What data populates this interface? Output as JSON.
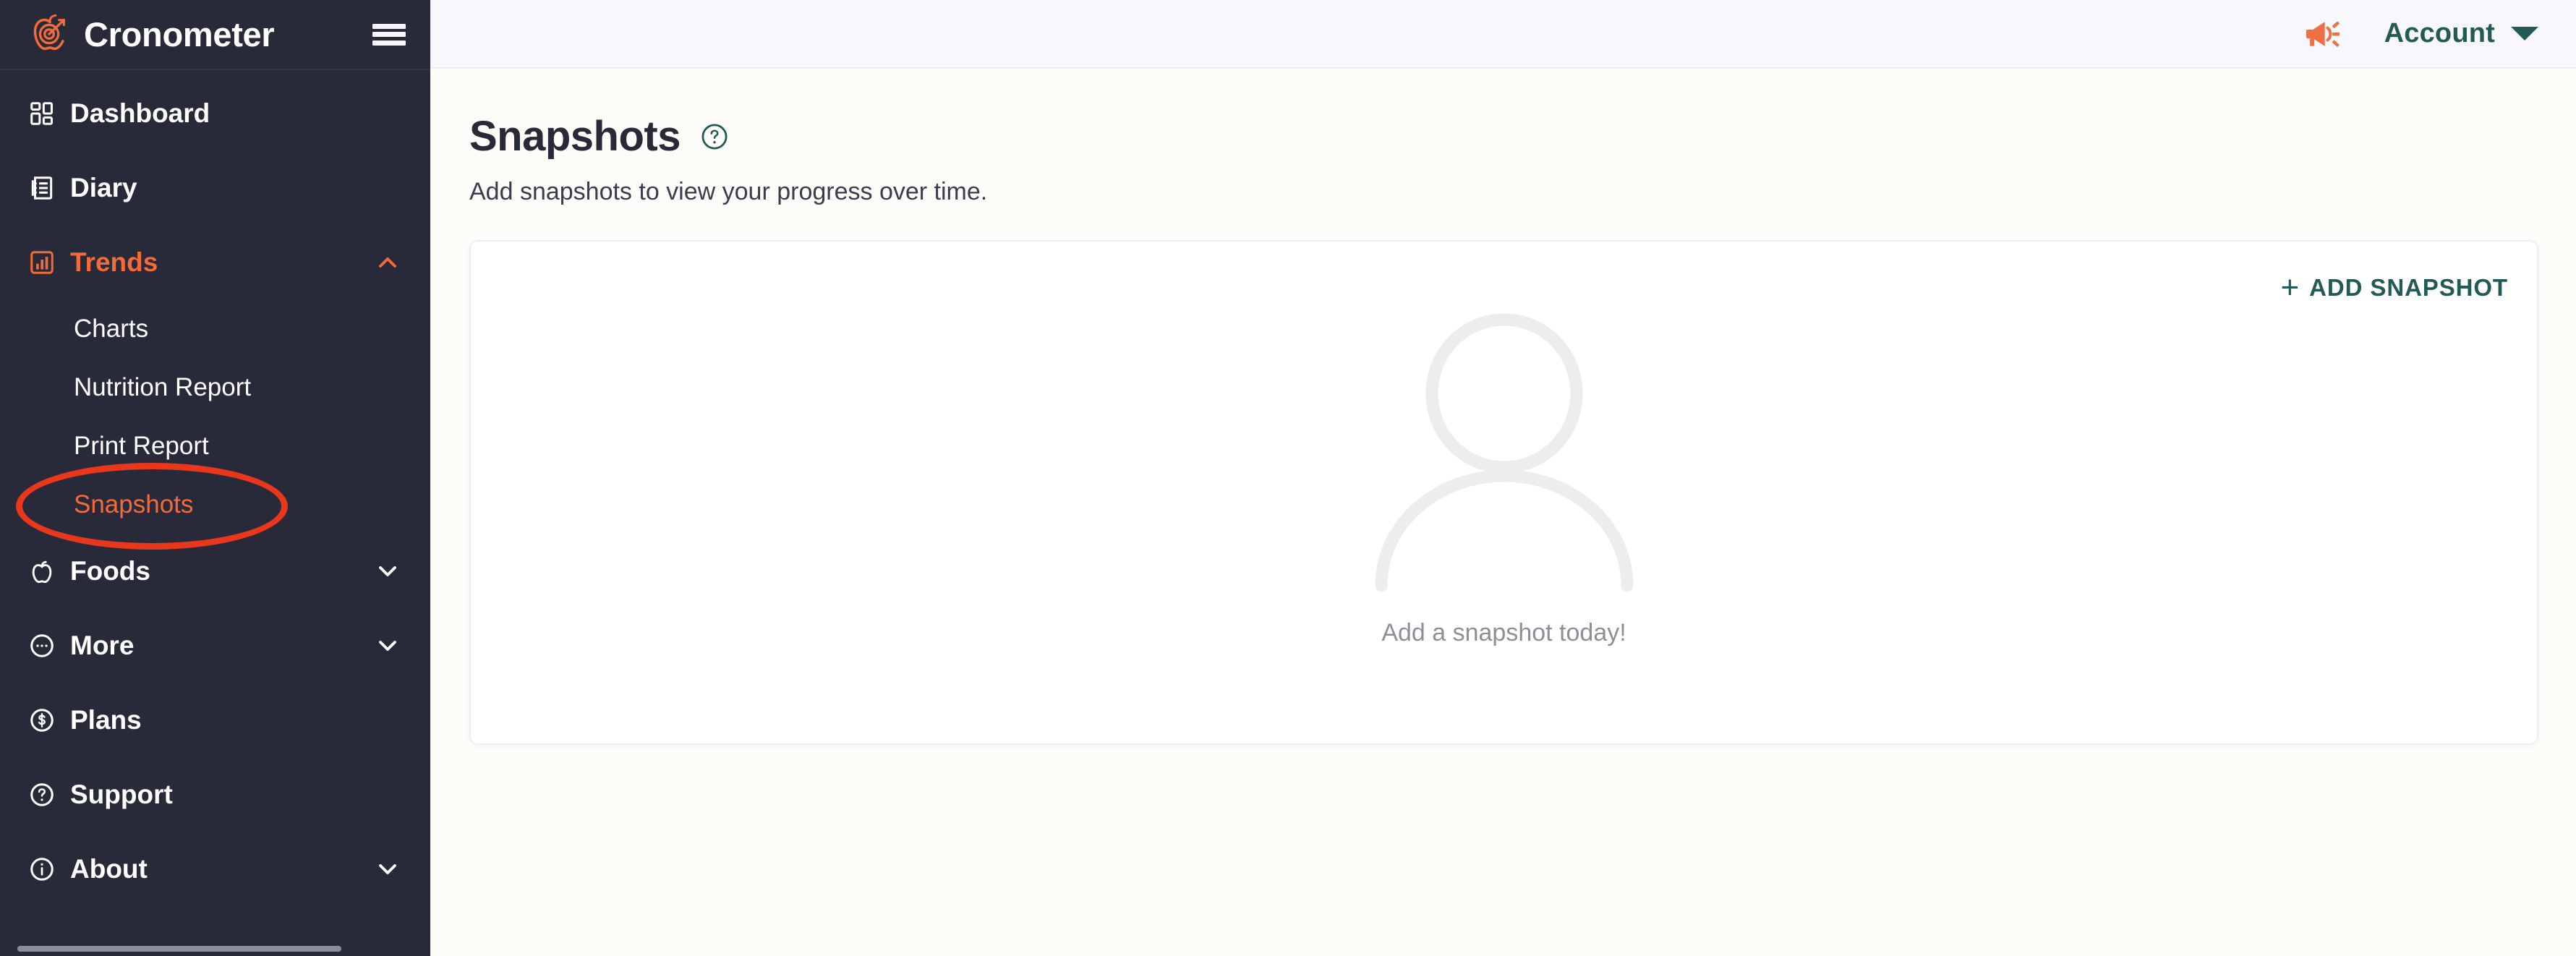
{
  "sidebar": {
    "brand": {
      "name": "Cronometer",
      "logo_icon": "cronometer-apple-target-logo"
    },
    "menu_icon": "hamburger-menu-icon",
    "items": [
      {
        "label": "Dashboard",
        "icon": "dashboard-grid-icon",
        "state": "default",
        "expandable": false
      },
      {
        "label": "Diary",
        "icon": "diary-notebook-icon",
        "state": "default",
        "expandable": false
      },
      {
        "label": "Trends",
        "icon": "trends-bar-chart-icon",
        "state": "active",
        "expandable": true,
        "chevron": "chevron-up-icon"
      },
      {
        "label": "Foods",
        "icon": "foods-apple-icon",
        "state": "default",
        "expandable": true,
        "chevron": "chevron-down-icon"
      },
      {
        "label": "More",
        "icon": "more-ellipsis-circle-icon",
        "state": "default",
        "expandable": true,
        "chevron": "chevron-down-icon"
      },
      {
        "label": "Plans",
        "icon": "plans-dollar-circle-icon",
        "state": "default",
        "expandable": false
      },
      {
        "label": "Support",
        "icon": "support-question-circle-icon",
        "state": "default",
        "expandable": false
      },
      {
        "label": "About",
        "icon": "about-info-circle-icon",
        "state": "default",
        "expandable": true,
        "chevron": "chevron-down-icon"
      }
    ],
    "trends_subitems": [
      {
        "label": "Charts",
        "state": "default"
      },
      {
        "label": "Nutrition Report",
        "state": "default"
      },
      {
        "label": "Print Report",
        "state": "default"
      },
      {
        "label": "Snapshots",
        "state": "current"
      }
    ],
    "scrollbar": "horizontal-scrollbar"
  },
  "topbar": {
    "announcements_icon": "megaphone-icon",
    "account_label": "Account",
    "account_caret_icon": "caret-down-icon"
  },
  "page": {
    "title": "Snapshots",
    "help_icon": "question-mark-circle-icon",
    "subtitle": "Add snapshots to view your progress over time."
  },
  "card": {
    "add_button_plus": "+",
    "add_button_label": "ADD SNAPSHOT",
    "add_button_icon": "plus-icon",
    "empty_illustration": "person-silhouette-placeholder",
    "empty_text": "Add a snapshot today!"
  },
  "annotation": {
    "shape": "ellipse-highlight",
    "target": "Snapshots",
    "color": "#E8371B"
  },
  "colors": {
    "sidebar_bg": "#282A3A",
    "accent_orange": "#F26B3A",
    "teal": "#245A55",
    "main_bg": "#FDFCF8",
    "topbar_bg": "#F8F8FC",
    "card_bg": "#FFFFFF",
    "muted_text": "#8E8E98",
    "annotation_red": "#E8371B"
  }
}
